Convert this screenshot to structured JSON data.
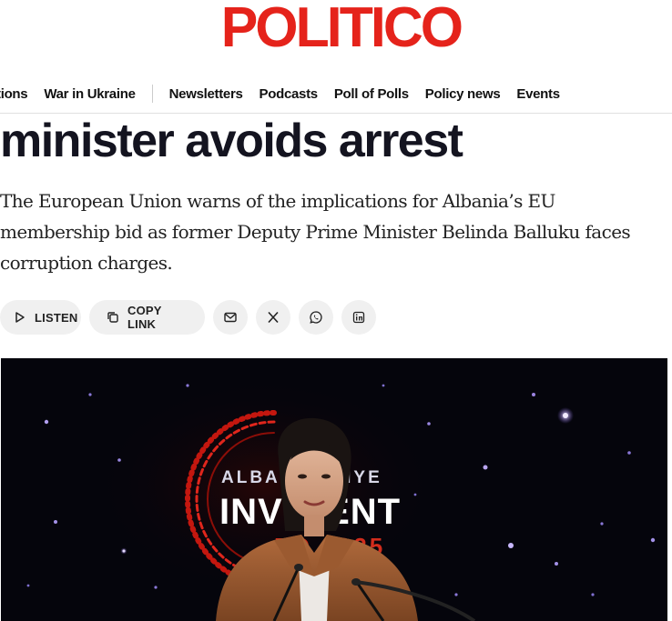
{
  "logo": {
    "text": "POLITICO"
  },
  "nav": {
    "items": [
      {
        "label": "tions"
      },
      {
        "label": "War in Ukraine"
      },
      {
        "label": "Newsletters"
      },
      {
        "label": "Podcasts"
      },
      {
        "label": "Poll of Polls"
      },
      {
        "label": "Policy news"
      },
      {
        "label": "Events"
      }
    ]
  },
  "article": {
    "headline": "minister avoids arrest",
    "dek": "The European Union warns of the implications for Albania’s EU membership bid as former Deputy Prime Minister Belinda Balluku faces corruption charges."
  },
  "actions": {
    "listen_label": "LISTEN",
    "copy_link_label": "COPY LINK",
    "icons": [
      "play-icon",
      "copy-icon",
      "email-icon",
      "x-icon",
      "whatsapp-icon",
      "linkedin-icon"
    ]
  },
  "photo": {
    "backdrop_line1": "ALBA   TÜRKIYE",
    "backdrop_line2": "INV   MENT",
    "backdrop_line3": "FO    2025"
  },
  "colors": {
    "brand": "#e5231b",
    "text": "#141420",
    "pill_bg": "#f0f0f0"
  }
}
